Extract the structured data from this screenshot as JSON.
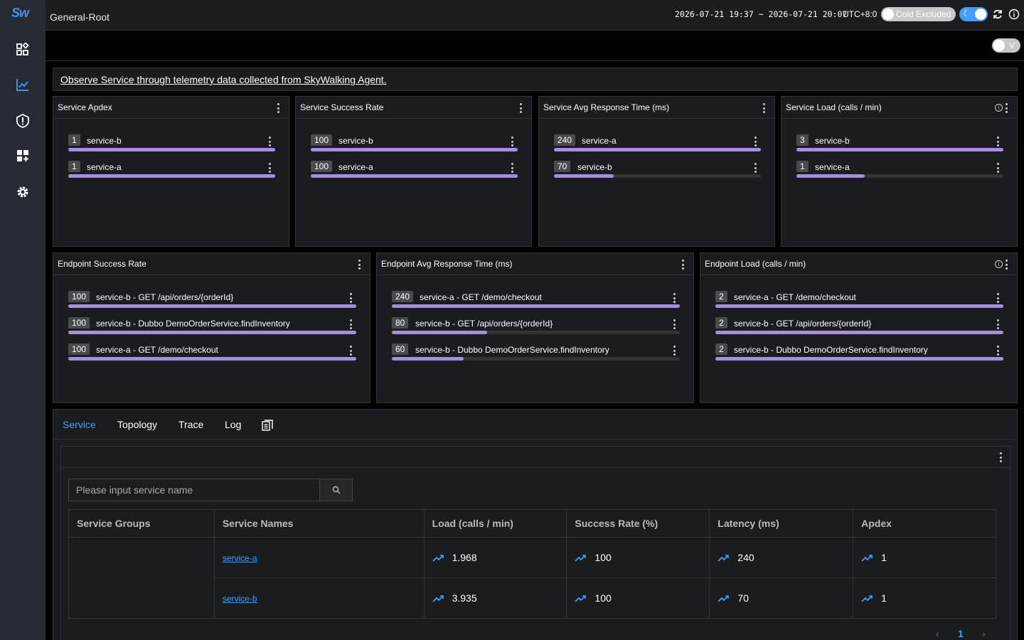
{
  "sidebar": {
    "logo_text": "Sw"
  },
  "header": {
    "title": "General-Root",
    "time_range": "2026-07-21 19:37 ~ 2026-07-21 20:07",
    "timezone": "UTC+8:0",
    "cold_label": "Cold Excluded",
    "v_label": "V"
  },
  "description": "Observe Service through telemetry data collected from SkyWalking Agent.",
  "top_cards": [
    {
      "title": "Service Apdex",
      "rows": [
        {
          "value": "1",
          "name": "service-b",
          "fill": 1.0
        },
        {
          "value": "1",
          "name": "service-a",
          "fill": 1.0
        }
      ]
    },
    {
      "title": "Service Success Rate",
      "rows": [
        {
          "value": "100",
          "name": "service-b",
          "fill": 1.0
        },
        {
          "value": "100",
          "name": "service-a",
          "fill": 1.0
        }
      ]
    },
    {
      "title": "Service Avg Response Time (ms)",
      "rows": [
        {
          "value": "240",
          "name": "service-a",
          "fill": 1.0
        },
        {
          "value": "70",
          "name": "service-b",
          "fill": 0.29
        }
      ]
    },
    {
      "title": "Service Load (calls / min)",
      "rows": [
        {
          "value": "3",
          "name": "service-b",
          "fill": 1.0
        },
        {
          "value": "1",
          "name": "service-a",
          "fill": 0.33
        }
      ]
    }
  ],
  "mid_cards": [
    {
      "title": "Endpoint Success Rate",
      "rows": [
        {
          "value": "100",
          "name": "service-b - GET /api/orders/{orderId}",
          "fill": 1.0
        },
        {
          "value": "100",
          "name": "service-b - Dubbo DemoOrderService.findInventory",
          "fill": 1.0
        },
        {
          "value": "100",
          "name": "service-a - GET /demo/checkout",
          "fill": 1.0
        }
      ]
    },
    {
      "title": "Endpoint Avg Response Time (ms)",
      "rows": [
        {
          "value": "240",
          "name": "service-a - GET /demo/checkout",
          "fill": 1.0
        },
        {
          "value": "80",
          "name": "service-b - GET /api/orders/{orderId}",
          "fill": 0.33
        },
        {
          "value": "60",
          "name": "service-b - Dubbo DemoOrderService.findInventory",
          "fill": 0.25
        }
      ]
    },
    {
      "title": "Endpoint Load (calls / min)",
      "rows": [
        {
          "value": "2",
          "name": "service-a - GET /demo/checkout",
          "fill": 1.0
        },
        {
          "value": "2",
          "name": "service-b - GET /api/orders/{orderId}",
          "fill": 1.0
        },
        {
          "value": "2",
          "name": "service-b - Dubbo DemoOrderService.findInventory",
          "fill": 1.0
        }
      ]
    }
  ],
  "tabs": [
    "Service",
    "Topology",
    "Trace",
    "Log"
  ],
  "search": {
    "placeholder": "Please input service name"
  },
  "table": {
    "headers": [
      "Service Groups",
      "Service Names",
      "Load (calls / min)",
      "Success Rate (%)",
      "Latency (ms)",
      "Apdex"
    ],
    "rows": [
      {
        "group": "",
        "name": "service-a",
        "load": "1.968",
        "success": "100",
        "latency": "240",
        "apdex": "1"
      },
      {
        "group": "",
        "name": "service-b",
        "load": "3.935",
        "success": "100",
        "latency": "70",
        "apdex": "1"
      }
    ]
  },
  "pagination": {
    "current": "1"
  },
  "colors": {
    "accent": "#409eff",
    "bar": "#a58de0",
    "sidebar": "#252a33",
    "panel": "#1b1c1e"
  }
}
